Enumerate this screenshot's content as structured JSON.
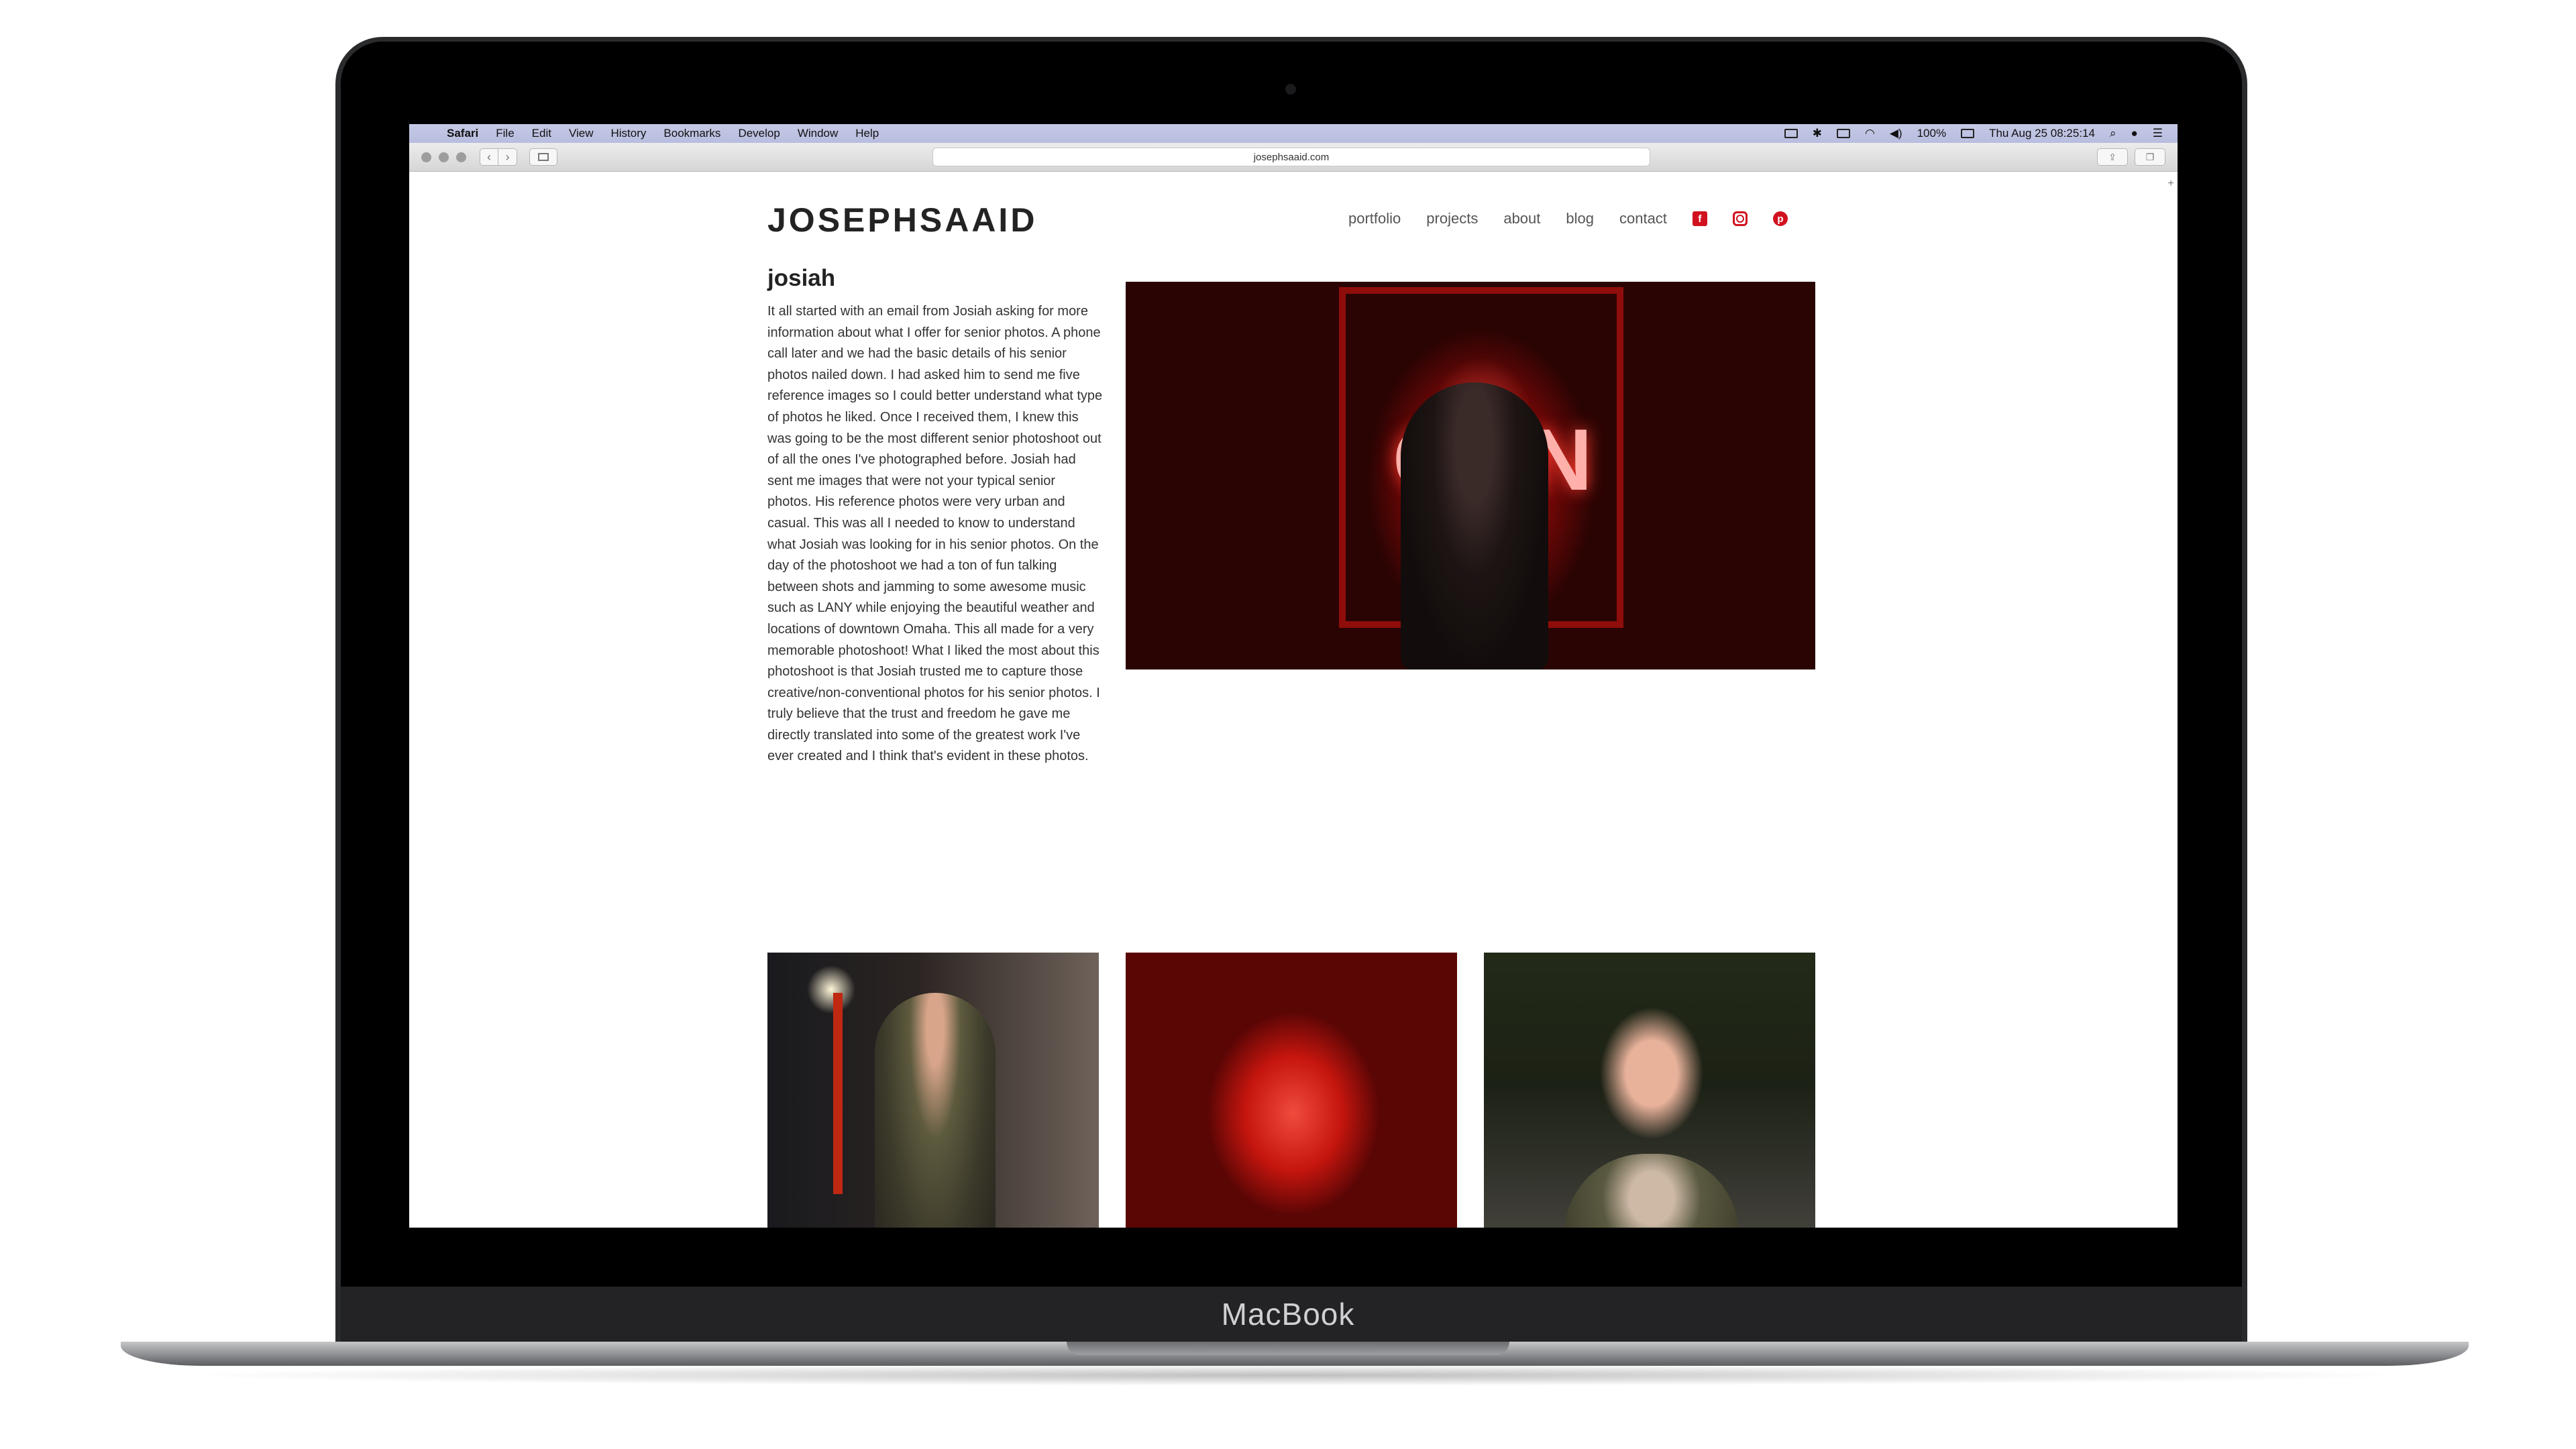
{
  "device": {
    "label": "MacBook"
  },
  "menubar": {
    "apple_glyph": "",
    "items": [
      "Safari",
      "File",
      "Edit",
      "View",
      "History",
      "Bookmarks",
      "Develop",
      "Window",
      "Help"
    ],
    "battery": "100%",
    "datetime": "Thu Aug 25   08:25:14"
  },
  "browser": {
    "url": "josephsaaid.com",
    "back": "‹",
    "forward": "›",
    "new_tab": "+"
  },
  "site": {
    "logo": "JOSEPHSAAID",
    "nav": [
      "portfolio",
      "projects",
      "about",
      "blog",
      "contact"
    ],
    "social": {
      "facebook": "f",
      "pinterest": "p"
    },
    "accent_color": "#d2111f",
    "title": "josiah",
    "story": "It all started with an email from Josiah asking for more information about what I offer for senior photos. A phone call later and we had the basic details of his senior photos nailed down. I had asked him to send me five reference images so I could better understand what type of photos he liked. Once I received them, I knew this was going to be the most different senior photoshoot out of all the ones I've photographed before. Josiah had sent me images that were not your typical senior photos. His reference photos were very urban and casual. This was all I needed to know to understand what Josiah was looking for in his senior photos. On the day of the photoshoot we had a ton of fun talking between shots and jamming to some awesome music such as LANY while enjoying the beautiful weather and locations of downtown Omaha. This all made for a very memorable photoshoot! What I liked the most about this photoshoot is that Josiah trusted me to capture those creative/non-conventional photos for his senior photos. I truly believe that the trust and freedom he gave me directly translated into some of the greatest work I've ever created and I think that's evident in these photos.",
    "hero_neon": "CAN"
  }
}
